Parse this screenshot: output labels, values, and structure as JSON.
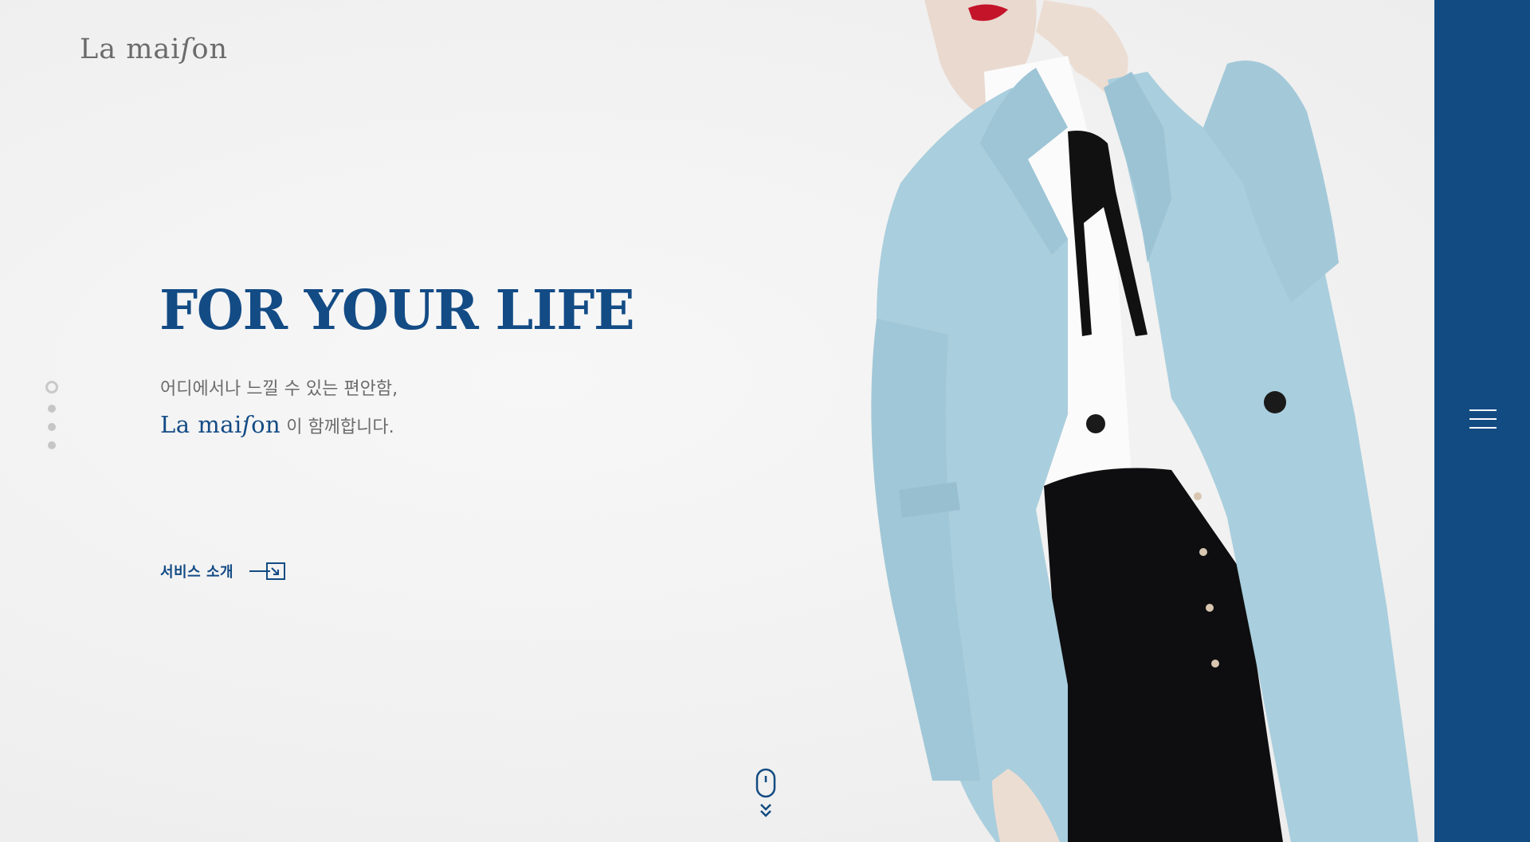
{
  "brand": {
    "logo_main": "La mai",
    "logo_s": "ſ",
    "logo_end": "on"
  },
  "hero": {
    "headline": "FOR YOUR LIFE",
    "subcopy_line1": "어디에서나 느낄 수 있는 편안함,",
    "subcopy_brand_main": "La mai",
    "subcopy_brand_s": "ſ",
    "subcopy_brand_end": "on",
    "subcopy_line2_suffix": " 이 함께합니다."
  },
  "cta": {
    "service_label": "서비스 소개"
  },
  "pagination": {
    "active_index": 0,
    "count": 4
  },
  "icons": {
    "menu": "hamburger-menu-icon",
    "scroll": "mouse-scroll-icon",
    "arrow": "arrow-box-icon"
  },
  "colors": {
    "primary": "#124b82",
    "text_gray": "#6b6b6b",
    "coat": "#a9cedd",
    "background": "#f2f2f2"
  }
}
